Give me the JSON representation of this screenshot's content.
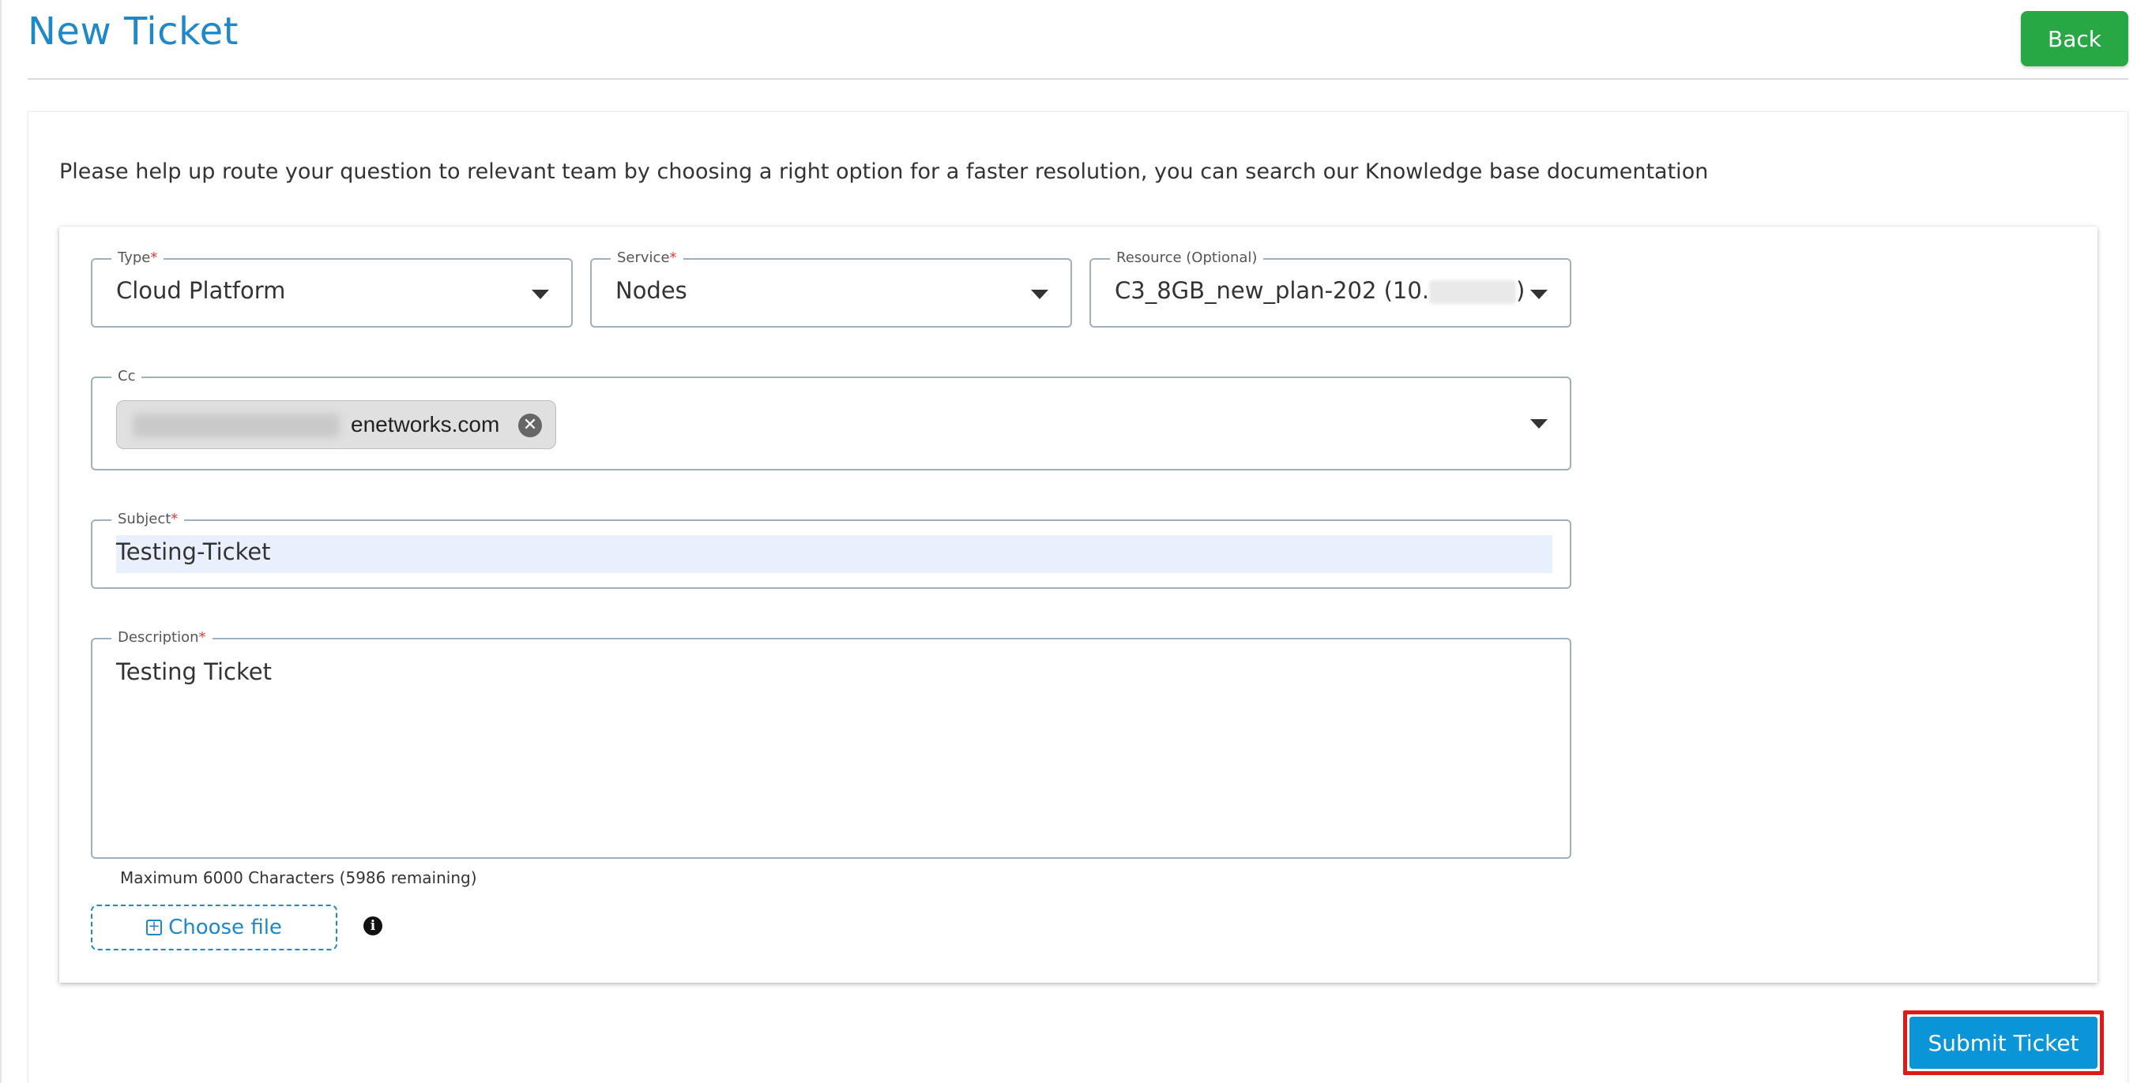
{
  "header": {
    "title": "New Ticket",
    "back_label": "Back"
  },
  "intro": "Please help up route your question to relevant team by choosing a right option for a faster resolution, you can search our Knowledge base documentation",
  "form": {
    "type": {
      "label": "Type",
      "required": "*",
      "value": "Cloud Platform"
    },
    "service": {
      "label": "Service",
      "required": "*",
      "value": "Nodes"
    },
    "resource": {
      "label": "Resource (Optional)",
      "value_prefix": "C3_8GB_new_plan-202 (10.",
      "value_suffix": ")"
    },
    "cc": {
      "label": "Cc",
      "chip_text": "enetworks.com",
      "remove_symbol": "✕"
    },
    "subject": {
      "label": "Subject",
      "required": "*",
      "value": "Testing-Ticket"
    },
    "description": {
      "label": "Description",
      "required": "*",
      "value": "Testing Ticket"
    },
    "char_count": "Maximum 6000 Characters (5986 remaining)",
    "choose_file_label": "Choose file",
    "plus_symbol": "+",
    "info_symbol": "i"
  },
  "submit_label": "Submit Ticket",
  "colors": {
    "title": "#1e88c9",
    "back": "#28a745",
    "submit": "#0a95d8",
    "highlight_border": "#e01919",
    "required": "#e53935"
  }
}
